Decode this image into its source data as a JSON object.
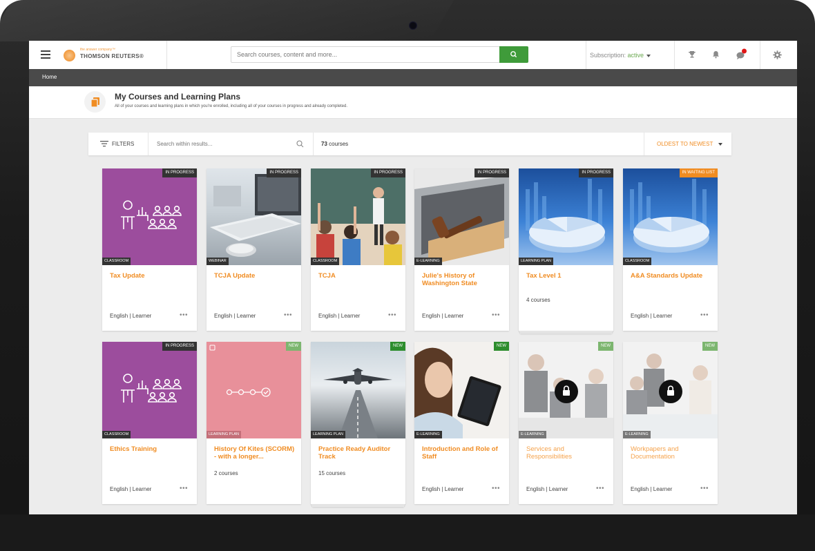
{
  "header": {
    "logo_tagline": "the answer company™",
    "logo_name": "THOMSON REUTERS®",
    "search_placeholder": "Search courses, content and more...",
    "subscription_label": "Subscription:",
    "subscription_value": "active"
  },
  "breadcrumb": {
    "home": "Home"
  },
  "page": {
    "title": "My Courses and Learning Plans",
    "subtitle": "All of your courses and learning plans in which you're enrolled, including all of your courses in progress and already completed."
  },
  "filterbar": {
    "filters_label": "FILTERS",
    "search_placeholder": "Search within results...",
    "count_number": "73",
    "count_unit": "courses",
    "sort_label": "OLDEST TO NEWEST"
  },
  "colors": {
    "accent_orange": "#f08c22",
    "search_green": "#3f9b3a",
    "classroom_purple": "#9c4d9d",
    "plan_pink": "#e8909a"
  },
  "cards": [
    {
      "status": "IN PROGRESS",
      "type": "CLASSROOM",
      "title": "Tax Update",
      "meta": "English | Learner",
      "dots": "•••",
      "thumb": "classroom-icon"
    },
    {
      "status": "IN PROGRESS",
      "type": "WEBINAR",
      "title": "TCJA Update",
      "meta": "English | Learner",
      "dots": "•••",
      "thumb": "computer-lab-photo"
    },
    {
      "status": "IN PROGRESS",
      "type": "CLASSROOM",
      "title": "TCJA",
      "meta": "English | Learner",
      "dots": "•••",
      "thumb": "classroom-photo"
    },
    {
      "status": "IN PROGRESS",
      "type": "E-LEARNING",
      "title": "Julie's History of Washington State",
      "meta": "English | Learner",
      "dots": "•••",
      "thumb": "gavel-laptop-photo"
    },
    {
      "status": "IN PROGRESS",
      "type": "LEARNING PLAN",
      "title": "Tax Level 1",
      "count": "4 courses",
      "thumb": "pie-chart-photo"
    },
    {
      "status": "IN WAITING LIST",
      "type": "CLASSROOM",
      "title": "A&A Standards Update",
      "meta": "English | Learner",
      "dots": "•••",
      "thumb": "pie-chart-photo"
    },
    {
      "status": "IN PROGRESS",
      "type": "CLASSROOM",
      "title": "Ethics Training",
      "meta": "English | Learner",
      "dots": "•••",
      "thumb": "classroom-icon"
    },
    {
      "status": "NEW",
      "type": "LEARNING PLAN",
      "title": "History Of Kites (SCORM) - with a longer...",
      "count": "2 courses",
      "thumb": "plan-steps-icon"
    },
    {
      "status": "NEW",
      "type": "LEARNING PLAN",
      "title": "Practice Ready Auditor Track",
      "count": "15 courses",
      "thumb": "airplane-photo"
    },
    {
      "status": "NEW",
      "type": "E-LEARNING",
      "title": "Introduction and Role of Staff",
      "meta": "English | Learner",
      "dots": "•••",
      "thumb": "tablet-woman-photo"
    },
    {
      "status": "NEW",
      "type": "E-LEARNING",
      "title": "Services and Responsibilities",
      "meta": "English | Learner",
      "dots": "•••",
      "thumb": "meeting-photo",
      "locked": true
    },
    {
      "status": "NEW",
      "type": "E-LEARNING",
      "title": "Workpapers and Documentation",
      "meta": "English | Learner",
      "dots": "•••",
      "thumb": "meeting-photo",
      "locked": true
    }
  ]
}
